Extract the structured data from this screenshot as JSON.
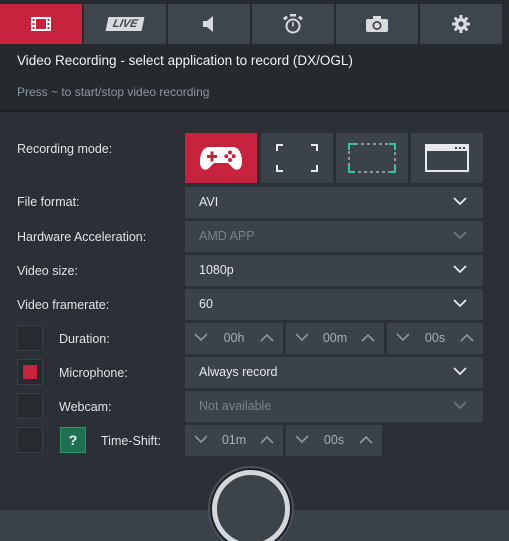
{
  "tabs": [
    {
      "icon": "film-icon",
      "active": true
    },
    {
      "icon": "live-icon",
      "label": "LIVE",
      "active": false
    },
    {
      "icon": "speaker-icon",
      "active": false
    },
    {
      "icon": "stopwatch-icon",
      "active": false
    },
    {
      "icon": "camera-icon",
      "active": false
    },
    {
      "icon": "gear-icon",
      "active": false
    }
  ],
  "header": {
    "title": "Video Recording - select application to record (DX/OGL)",
    "hint": "Press ~ to start/stop video recording"
  },
  "recording_mode": {
    "label": "Recording mode:",
    "options": [
      "gamepad-icon",
      "fullscreen-icon",
      "region-icon",
      "window-icon"
    ],
    "selected": 0
  },
  "file_format": {
    "label": "File format:",
    "value": "AVI"
  },
  "hw_accel": {
    "label": "Hardware Acceleration:",
    "value": "AMD APP"
  },
  "video_size": {
    "label": "Video size:",
    "value": "1080p"
  },
  "video_framerate": {
    "label": "Video framerate:",
    "value": "60"
  },
  "duration": {
    "label": "Duration:",
    "checked": false,
    "hours": "00h",
    "minutes": "00m",
    "seconds": "00s"
  },
  "microphone": {
    "label": "Microphone:",
    "checked": true,
    "value": "Always record"
  },
  "webcam": {
    "label": "Webcam:",
    "checked": false,
    "value": "Not available"
  },
  "timeshift": {
    "label": "Time-Shift:",
    "checked": false,
    "help": "?",
    "minutes": "01m",
    "seconds": "00s"
  },
  "colors": {
    "accent": "#c8233e",
    "panel": "#3b424a",
    "background": "#2b3036",
    "help": "#1e7150"
  }
}
